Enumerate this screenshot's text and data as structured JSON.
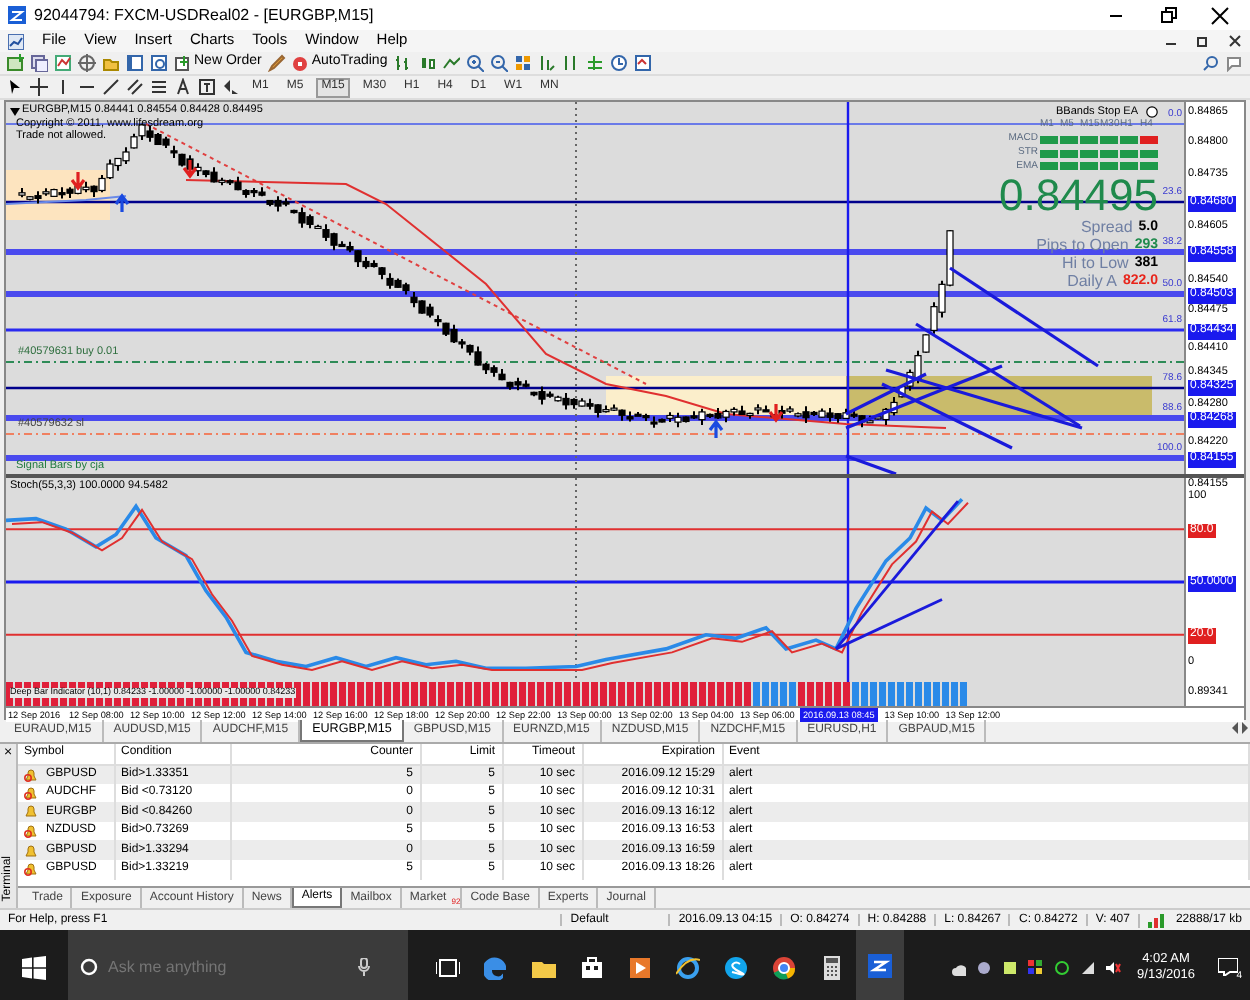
{
  "window": {
    "title": "92044794: FXCM-USDReal02 - [EURGBP,M15]"
  },
  "menu": [
    "File",
    "View",
    "Insert",
    "Charts",
    "Tools",
    "Window",
    "Help"
  ],
  "toolbar": {
    "buttons": [
      {
        "label": "New Order"
      },
      {
        "label": "AutoTrading"
      }
    ]
  },
  "timeframes": [
    {
      "label": "M1",
      "selected": false
    },
    {
      "label": "M5",
      "selected": false
    },
    {
      "label": "M15",
      "selected": true
    },
    {
      "label": "M30",
      "selected": false
    },
    {
      "label": "H1",
      "selected": false
    },
    {
      "label": "H4",
      "selected": false
    },
    {
      "label": "D1",
      "selected": false
    },
    {
      "label": "W1",
      "selected": false
    },
    {
      "label": "MN",
      "selected": false
    }
  ],
  "chart": {
    "header": "EURGBP,M15  0.84441 0.84554 0.84428 0.84495",
    "notes": [
      "Copyright © 2011, www.lifesdream.org",
      "Trade not allowed."
    ],
    "order_labels": [
      "#40579631 buy 0.01",
      "#40579632 sl"
    ],
    "indicator_label": "Signal Bars by cja",
    "fib_levels": [
      "0.0",
      "23.6",
      "38.2",
      "50.0",
      "61.8",
      "78.6",
      "88.6",
      "100.0"
    ],
    "price_axis": [
      {
        "text": "0.84865",
        "boxed": false
      },
      {
        "text": "0.84800",
        "boxed": false
      },
      {
        "text": "0.84735",
        "boxed": false
      },
      {
        "text": "0.84680",
        "boxed": true
      },
      {
        "text": "0.84605",
        "boxed": false
      },
      {
        "text": "0.84558",
        "boxed": true
      },
      {
        "text": "0.84540",
        "boxed": false
      },
      {
        "text": "0.84503",
        "boxed": true
      },
      {
        "text": "0.84475",
        "boxed": false
      },
      {
        "text": "0.84434",
        "boxed": true
      },
      {
        "text": "0.84410",
        "boxed": false
      },
      {
        "text": "0.84345",
        "boxed": false
      },
      {
        "text": "0.84325",
        "boxed": true
      },
      {
        "text": "0.84280",
        "boxed": false
      },
      {
        "text": "0.84268",
        "boxed": true
      },
      {
        "text": "0.84220",
        "boxed": false
      },
      {
        "text": "0.84155",
        "boxed": true
      }
    ],
    "ea_panel": {
      "title": "BBands Stop EA",
      "timeframes": [
        "M1",
        "M5",
        "M15",
        "M30",
        "H1",
        "H4"
      ],
      "rows": [
        {
          "label": "MACD",
          "cells": [
            {
              "color": "#1f9a4a"
            },
            {
              "color": "#1f9a4a"
            },
            {
              "color": "#1f9a4a"
            },
            {
              "color": "#1f9a4a"
            },
            {
              "color": "#1f9a4a"
            },
            {
              "color": "#e02020"
            }
          ]
        },
        {
          "label": "STR",
          "cells": [
            {
              "color": "#1f9a4a"
            },
            {
              "color": "#1f9a4a"
            },
            {
              "color": "#1f9a4a"
            },
            {
              "color": "#1f9a4a"
            },
            {
              "color": "#1f9a4a"
            },
            {
              "color": "#1f9a4a"
            }
          ]
        },
        {
          "label": "EMA",
          "cells": [
            {
              "color": "#1f9a4a"
            },
            {
              "color": "#1f9a4a"
            },
            {
              "color": "#1f9a4a"
            },
            {
              "color": "#1f9a4a"
            },
            {
              "color": "#1f9a4a"
            },
            {
              "color": "#1f9a4a"
            }
          ]
        }
      ],
      "price": "0.84495",
      "stats": [
        {
          "label": "Spread",
          "value": "5.0",
          "color": "#000000"
        },
        {
          "label": "Pips to Open",
          "value": "293",
          "color": "#1f8a4c"
        },
        {
          "label": "Hi to Low",
          "value": "381",
          "color": "#000000"
        },
        {
          "label": "Daily A",
          "value": "822.0",
          "color": "#e8251b"
        }
      ]
    }
  },
  "oscillator": {
    "label": "Stoch(55,3,3) 100.0000 94.5482",
    "top_price": "0.84155",
    "axis": [
      {
        "text": "100"
      },
      {
        "text": "80.0",
        "color": "#e02020"
      },
      {
        "text": "50.0000",
        "color": "#1a1aee"
      },
      {
        "text": "20.0",
        "color": "#e02020"
      },
      {
        "text": "0"
      }
    ]
  },
  "histogram": {
    "label": "Deep Bar Indicator (10,1) 0.84233 -1.00000 -1.00000 -1.00000 0.84233",
    "axis": "0.89341"
  },
  "time_axis": [
    {
      "text": "12 Sep 2016",
      "highlighted": false
    },
    {
      "text": "12 Sep 08:00",
      "highlighted": false
    },
    {
      "text": "12 Sep 10:00",
      "highlighted": false
    },
    {
      "text": "12 Sep 12:00",
      "highlighted": false
    },
    {
      "text": "12 Sep 14:00",
      "highlighted": false
    },
    {
      "text": "12 Sep 16:00",
      "highlighted": false
    },
    {
      "text": "12 Sep 18:00",
      "highlighted": false
    },
    {
      "text": "12 Sep 20:00",
      "highlighted": false
    },
    {
      "text": "12 Sep 22:00",
      "highlighted": false
    },
    {
      "text": "13 Sep 00:00",
      "highlighted": false
    },
    {
      "text": "13 Sep 02:00",
      "highlighted": false
    },
    {
      "text": "13 Sep 04:00",
      "highlighted": false
    },
    {
      "text": "13 Sep 06:00",
      "highlighted": false
    },
    {
      "text": "2016.09.13 08:45",
      "highlighted": true
    },
    {
      "text": "13 Sep 10:00",
      "highlighted": false
    },
    {
      "text": "13 Sep 12:00",
      "highlighted": false
    }
  ],
  "symbol_tabs": [
    {
      "label": "EURAUD,M15",
      "selected": false
    },
    {
      "label": "AUDUSD,M15",
      "selected": false
    },
    {
      "label": "AUDCHF,M15",
      "selected": false
    },
    {
      "label": "EURGBP,M15",
      "selected": true
    },
    {
      "label": "GBPUSD,M15",
      "selected": false
    },
    {
      "label": "EURNZD,M15",
      "selected": false
    },
    {
      "label": "NZDUSD,M15",
      "selected": false
    },
    {
      "label": "NZDCHF,M15",
      "selected": false
    },
    {
      "label": "EURUSD,H1",
      "selected": false
    },
    {
      "label": "GBPAUD,M15",
      "selected": false
    }
  ],
  "alerts": {
    "columns": [
      "Symbol",
      "Condition",
      "Counter",
      "Limit",
      "Timeout",
      "Expiration",
      "Event"
    ],
    "rows": [
      {
        "enabled": false,
        "cells": [
          "GBPUSD",
          "Bid>1.33351",
          "5",
          "5",
          "10 sec",
          "2016.09.12 15:29",
          "alert"
        ]
      },
      {
        "enabled": false,
        "cells": [
          "AUDCHF",
          "Bid <0.73120",
          "0",
          "5",
          "10 sec",
          "2016.09.12 10:31",
          "alert"
        ]
      },
      {
        "enabled": true,
        "cells": [
          "EURGBP",
          "Bid <0.84260",
          "0",
          "5",
          "10 sec",
          "2016.09.13 16:12",
          "alert"
        ]
      },
      {
        "enabled": false,
        "cells": [
          "NZDUSD",
          "Bid>0.73269",
          "5",
          "5",
          "10 sec",
          "2016.09.13 16:53",
          "alert"
        ]
      },
      {
        "enabled": true,
        "cells": [
          "GBPUSD",
          "Bid>1.33294",
          "0",
          "5",
          "10 sec",
          "2016.09.13 16:59",
          "alert"
        ]
      },
      {
        "enabled": false,
        "cells": [
          "GBPUSD",
          "Bid>1.33219",
          "5",
          "5",
          "10 sec",
          "2016.09.13 18:26",
          "alert"
        ]
      }
    ]
  },
  "terminal": {
    "title": "Terminal",
    "close": "×",
    "tabs": [
      {
        "label": "Trade",
        "selected": false
      },
      {
        "label": "Exposure",
        "selected": false
      },
      {
        "label": "Account History",
        "selected": false
      },
      {
        "label": "News",
        "selected": false
      },
      {
        "label": "Alerts",
        "selected": true
      },
      {
        "label": "Mailbox",
        "selected": false
      },
      {
        "label": "Market",
        "selected": false,
        "badge": "92"
      },
      {
        "label": "Code Base",
        "selected": false
      },
      {
        "label": "Experts",
        "selected": false
      },
      {
        "label": "Journal",
        "selected": false
      }
    ]
  },
  "status_bar": [
    "For Help, press F1",
    "Default",
    "2016.09.13 04:15",
    "O: 0.84274",
    "H: 0.84288",
    "L: 0.84267",
    "C: 0.84272",
    "V: 407",
    "22888/17 kb"
  ],
  "taskbar": {
    "search_placeholder": "Ask me anything",
    "time": "4:02 AM",
    "date": "9/13/2016",
    "notifications": "4"
  }
}
